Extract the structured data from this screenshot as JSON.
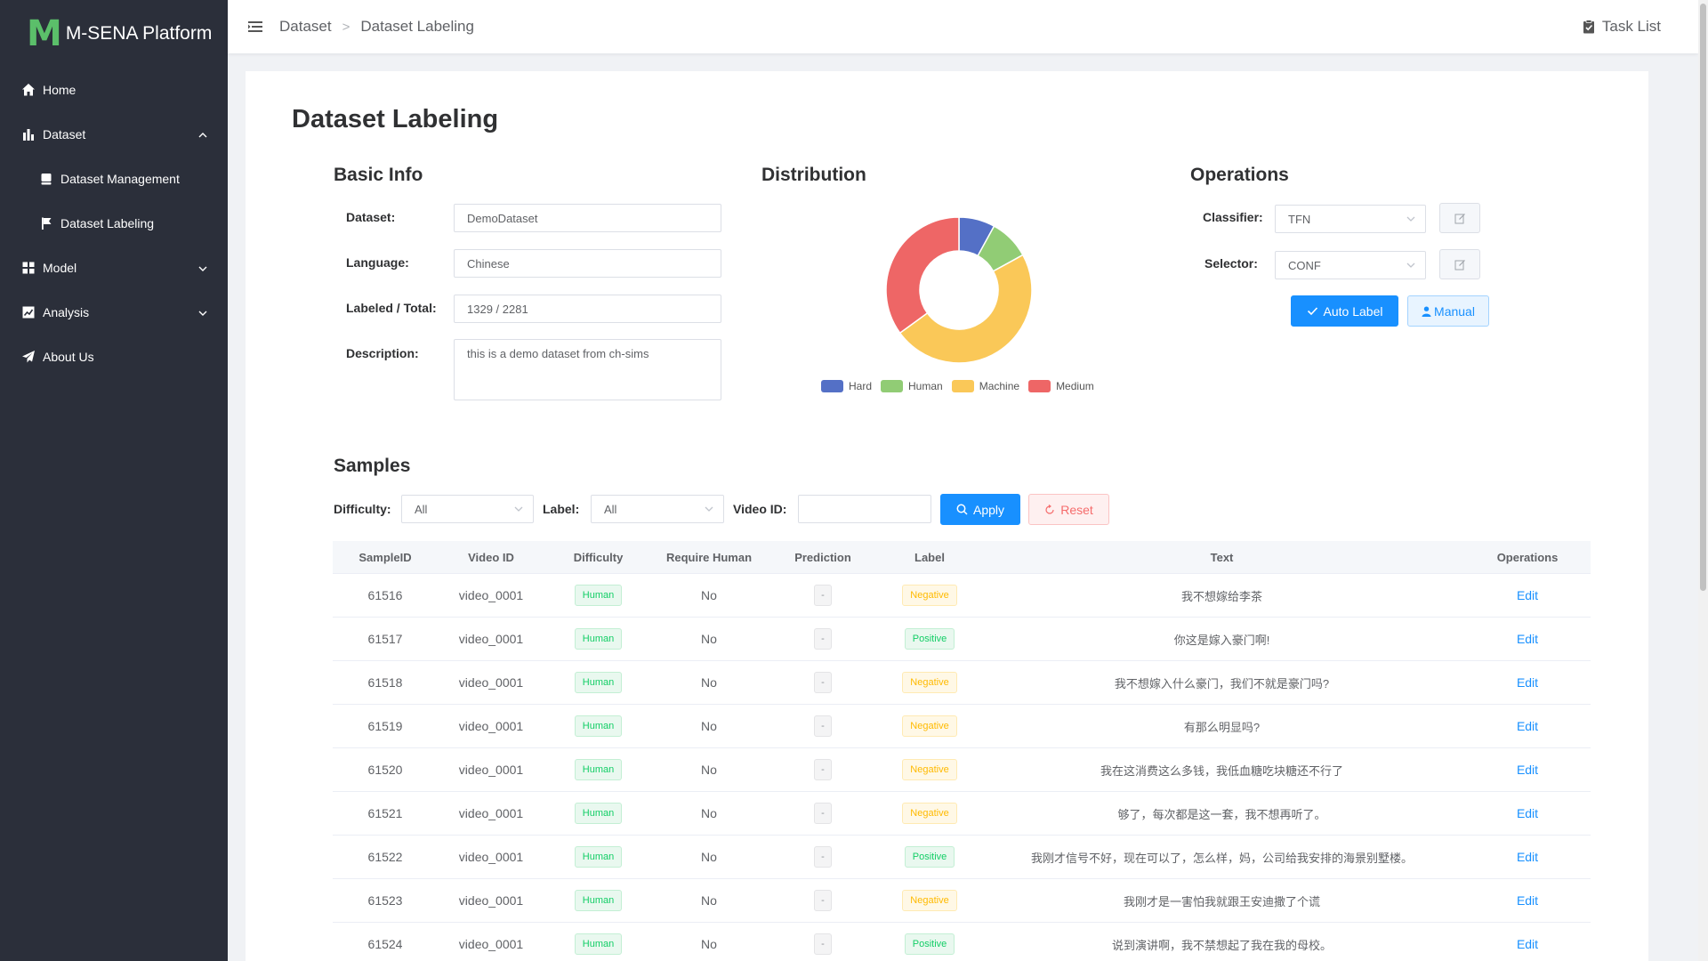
{
  "app": {
    "logo_letter": "M",
    "name": "M-SENA Platform"
  },
  "sidebar": {
    "items": [
      {
        "label": "Home",
        "icon": "home-icon"
      },
      {
        "label": "Dataset",
        "icon": "bar-chart-icon",
        "expanded": true
      },
      {
        "label": "Dataset Management",
        "icon": "database-icon"
      },
      {
        "label": "Dataset Labeling",
        "icon": "flag-icon"
      },
      {
        "label": "Model",
        "icon": "grid-icon"
      },
      {
        "label": "Analysis",
        "icon": "line-chart-icon"
      },
      {
        "label": "About Us",
        "icon": "paper-plane-icon"
      }
    ]
  },
  "header": {
    "breadcrumb": [
      "Dataset",
      "Dataset Labeling"
    ],
    "separator": ">",
    "task_list": "Task List"
  },
  "page": {
    "title": "Dataset Labeling"
  },
  "basic_info": {
    "title": "Basic Info",
    "dataset_label": "Dataset:",
    "dataset_value": "DemoDataset",
    "language_label": "Language:",
    "language_value": "Chinese",
    "labeled_label": "Labeled / Total:",
    "labeled_value": "1329 / 2281",
    "description_label": "Description:",
    "description_value": "this is a demo dataset from ch-sims"
  },
  "distribution": {
    "title": "Distribution"
  },
  "chart_data": {
    "type": "pie",
    "categories": [
      "Hard",
      "Human",
      "Machine",
      "Medium"
    ],
    "values": [
      8,
      9,
      48,
      35
    ],
    "colors": [
      "#5470c6",
      "#91cc75",
      "#fac858",
      "#ee6666"
    ],
    "donut": true,
    "legend_position": "bottom"
  },
  "operations": {
    "title": "Operations",
    "classifier_label": "Classifier:",
    "classifier_value": "TFN",
    "selector_label": "Selector:",
    "selector_value": "CONF",
    "auto_label": "Auto Label",
    "manual": "Manual"
  },
  "samples": {
    "title": "Samples",
    "difficulty_label": "Difficulty:",
    "difficulty_value": "All",
    "label_label": "Label:",
    "label_value": "All",
    "video_id_label": "Video ID:",
    "video_id_value": "",
    "apply": "Apply",
    "reset": "Reset",
    "columns": [
      "SampleID",
      "Video ID",
      "Difficulty",
      "Require Human",
      "Prediction",
      "Label",
      "Text",
      "Operations"
    ],
    "rows": [
      {
        "id": "61516",
        "video": "video_0001",
        "difficulty": "Human",
        "require": "No",
        "prediction": "-",
        "label": "Negative",
        "text": "我不想嫁给李茶",
        "op": "Edit"
      },
      {
        "id": "61517",
        "video": "video_0001",
        "difficulty": "Human",
        "require": "No",
        "prediction": "-",
        "label": "Positive",
        "text": "你这是嫁入豪门啊!",
        "op": "Edit"
      },
      {
        "id": "61518",
        "video": "video_0001",
        "difficulty": "Human",
        "require": "No",
        "prediction": "-",
        "label": "Negative",
        "text": "我不想嫁入什么豪门，我们不就是豪门吗?",
        "op": "Edit"
      },
      {
        "id": "61519",
        "video": "video_0001",
        "difficulty": "Human",
        "require": "No",
        "prediction": "-",
        "label": "Negative",
        "text": "有那么明显吗?",
        "op": "Edit"
      },
      {
        "id": "61520",
        "video": "video_0001",
        "difficulty": "Human",
        "require": "No",
        "prediction": "-",
        "label": "Negative",
        "text": "我在这消费这么多钱，我低血糖吃块糖还不行了",
        "op": "Edit"
      },
      {
        "id": "61521",
        "video": "video_0001",
        "difficulty": "Human",
        "require": "No",
        "prediction": "-",
        "label": "Negative",
        "text": "够了，每次都是这一套，我不想再听了。",
        "op": "Edit"
      },
      {
        "id": "61522",
        "video": "video_0001",
        "difficulty": "Human",
        "require": "No",
        "prediction": "-",
        "label": "Positive",
        "text": "我刚才信号不好，现在可以了，怎么样，妈，公司给我安排的海景别墅楼。",
        "op": "Edit"
      },
      {
        "id": "61523",
        "video": "video_0001",
        "difficulty": "Human",
        "require": "No",
        "prediction": "-",
        "label": "Negative",
        "text": "我刚才是一害怕我就跟王安迪撒了个谎",
        "op": "Edit"
      },
      {
        "id": "61524",
        "video": "video_0001",
        "difficulty": "Human",
        "require": "No",
        "prediction": "-",
        "label": "Positive",
        "text": "说到演讲啊，我不禁想起了我在我的母校。",
        "op": "Edit"
      }
    ]
  }
}
